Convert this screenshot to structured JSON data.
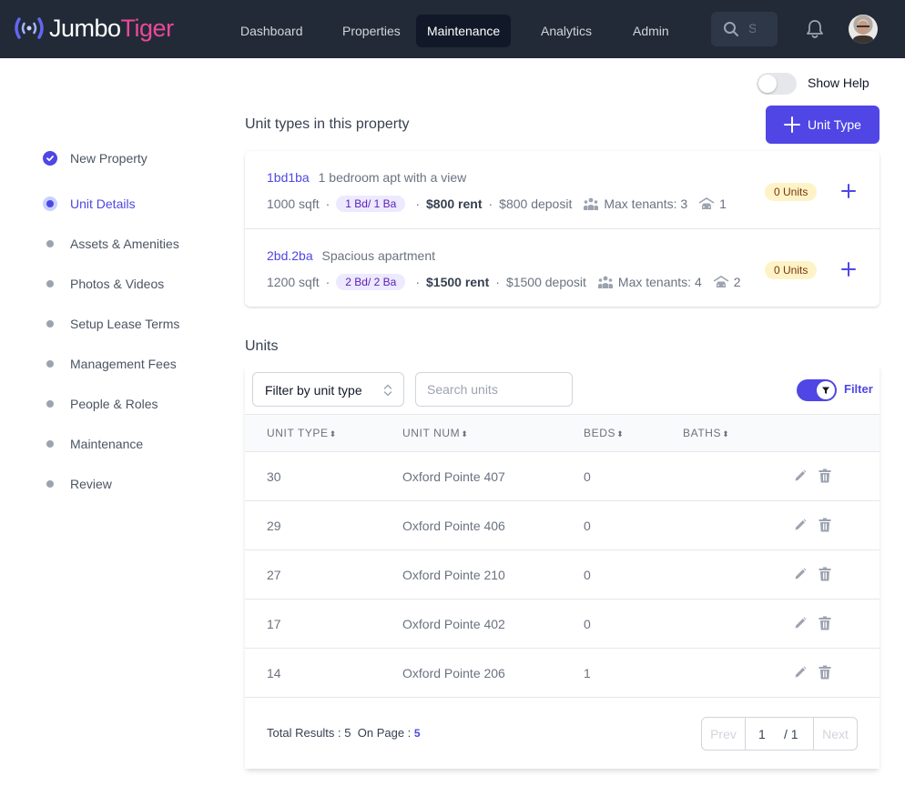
{
  "app": {
    "logo_part1": "Jumbo",
    "logo_part2": "Tiger",
    "brand_color": "#4f46e5",
    "accent_color": "#ec4899"
  },
  "nav": {
    "items": [
      {
        "label": "Dashboard",
        "active": false
      },
      {
        "label": "Properties",
        "active": false
      },
      {
        "label": "Maintenance",
        "active": true
      },
      {
        "label": "Analytics",
        "active": false
      },
      {
        "label": "Admin",
        "active": false
      }
    ],
    "search_placeholder": "Search",
    "icons": {
      "search": "search-icon",
      "notifications": "bell-icon",
      "profile": "avatar"
    }
  },
  "help": {
    "label": "Show Help",
    "enabled": false
  },
  "stepper": {
    "steps": [
      {
        "label": "New Property",
        "state": "done"
      },
      {
        "label": "Unit Details",
        "state": "current"
      },
      {
        "label": "Assets & Amenities",
        "state": "pending"
      },
      {
        "label": "Photos & Videos",
        "state": "pending"
      },
      {
        "label": "Setup Lease Terms",
        "state": "pending"
      },
      {
        "label": "Management Fees",
        "state": "pending"
      },
      {
        "label": "People & Roles",
        "state": "pending"
      },
      {
        "label": "Maintenance",
        "state": "pending"
      },
      {
        "label": "Review",
        "state": "pending"
      }
    ]
  },
  "unit_types": {
    "title": "Unit types in this property",
    "add_button": "Unit Type",
    "items": [
      {
        "code": "1bd1ba",
        "description": "1 bedroom apt with a view",
        "sqft": "1000 sqft",
        "bed_bath": "1 Bd/ 1 Ba",
        "rent": "$800 rent",
        "deposit": "$800 deposit",
        "max_tenants": "Max tenants: 3",
        "parking": "1",
        "units_badge": "0 Units"
      },
      {
        "code": "2bd.2ba",
        "description": "Spacious apartment",
        "sqft": "1200 sqft",
        "bed_bath": "2 Bd/ 2 Ba",
        "rent": "$1500 rent",
        "deposit": "$1500 deposit",
        "max_tenants": "Max tenants: 4",
        "parking": "2",
        "units_badge": "0 Units"
      }
    ]
  },
  "units": {
    "title": "Units",
    "filter_select_value": "Filter by unit type",
    "search_placeholder": "Search units",
    "filter_toggle_label": "Filter",
    "filter_enabled": true,
    "columns": [
      "UNIT TYPE",
      "UNIT NUM",
      "BEDS",
      "BATHS"
    ],
    "sort_glyph": "⬍",
    "rows": [
      {
        "unit_type": "30",
        "unit_num": "Oxford Pointe 407",
        "beds": "0",
        "baths": ""
      },
      {
        "unit_type": "29",
        "unit_num": "Oxford Pointe 406",
        "beds": "0",
        "baths": ""
      },
      {
        "unit_type": "27",
        "unit_num": "Oxford Pointe 210",
        "beds": "0",
        "baths": ""
      },
      {
        "unit_type": "17",
        "unit_num": "Oxford Pointe 402",
        "beds": "0",
        "baths": ""
      },
      {
        "unit_type": "14",
        "unit_num": "Oxford Pointe 206",
        "beds": "1",
        "baths": ""
      }
    ],
    "footer": {
      "total_label": "Total Results : 5",
      "on_page_label": "On Page :",
      "on_page_value": "5"
    },
    "pagination": {
      "prev": "Prev",
      "current": "1",
      "total": "/ 1",
      "next": "Next"
    }
  }
}
